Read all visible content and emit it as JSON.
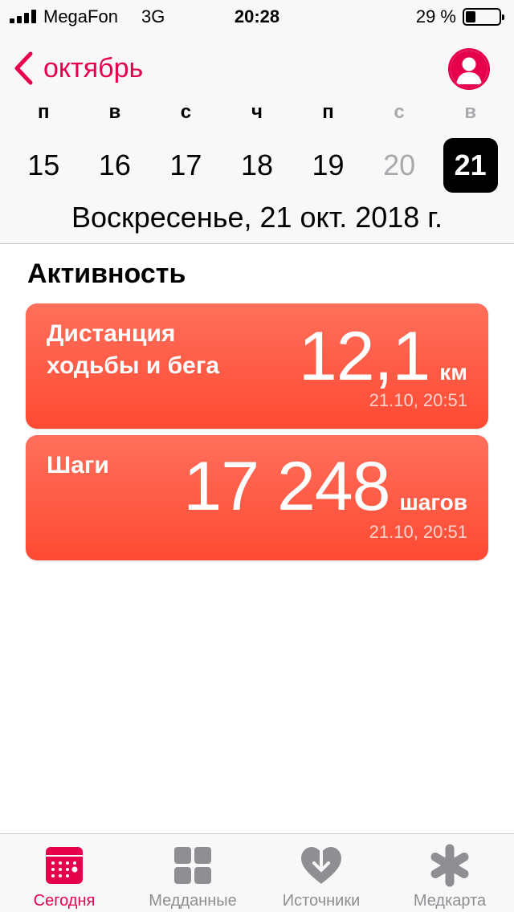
{
  "status_bar": {
    "carrier": "MegaFon",
    "network": "3G",
    "time": "20:28",
    "battery_percent": "29 %",
    "battery_level": 0.29
  },
  "nav": {
    "back_label": "октябрь",
    "back_icon": "chevron-left-icon",
    "profile_icon": "person-icon"
  },
  "week": {
    "days": [
      {
        "name": "п",
        "date": "15"
      },
      {
        "name": "в",
        "date": "16"
      },
      {
        "name": "с",
        "date": "17"
      },
      {
        "name": "ч",
        "date": "18"
      },
      {
        "name": "п",
        "date": "19"
      },
      {
        "name": "с",
        "date": "20"
      },
      {
        "name": "в",
        "date": "21"
      }
    ],
    "selected": "21",
    "full_date": "Воскресенье, 21 окт. 2018 г."
  },
  "activity": {
    "title": "Активность",
    "cards": [
      {
        "name_line1": "Дистанция",
        "name_line2": "ходьбы и бега",
        "value": "12,1",
        "unit": "км",
        "timestamp": "21.10, 20:51"
      },
      {
        "name_line1": "Шаги",
        "value": "17 248",
        "unit": "шагов",
        "timestamp": "21.10, 20:51"
      }
    ]
  },
  "tabs": [
    {
      "label": "Сегодня",
      "icon": "calendar-icon",
      "active": true
    },
    {
      "label": "Медданные",
      "icon": "grid-icon",
      "active": false
    },
    {
      "label": "Источники",
      "icon": "heart-download-icon",
      "active": false
    },
    {
      "label": "Медкарта",
      "icon": "asterisk-icon",
      "active": false
    }
  ],
  "colors": {
    "accent": "#e6004c",
    "card_top": "#ff6f5b",
    "card_bottom": "#ff4a33",
    "inactive": "#8e8e93"
  }
}
